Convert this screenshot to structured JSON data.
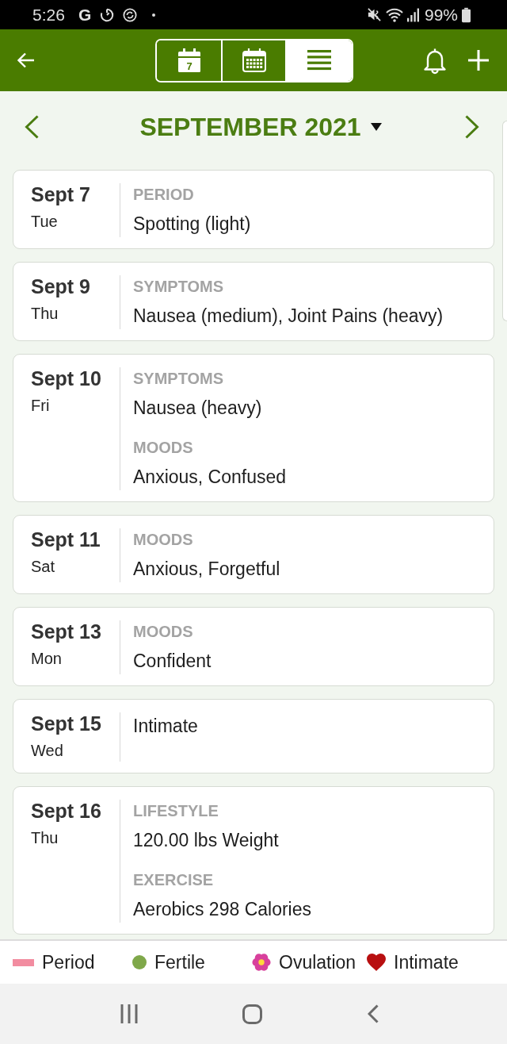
{
  "status_bar": {
    "time": "5:26",
    "app_letter": "G",
    "battery": "99%"
  },
  "view_tabs": [
    {
      "kind": "week",
      "selected": false,
      "badge": "7"
    },
    {
      "kind": "month",
      "selected": false
    },
    {
      "kind": "list",
      "selected": true
    }
  ],
  "header": {
    "title": "SEPTEMBER 2021"
  },
  "entries": [
    {
      "date": "Sept 7",
      "weekday": "Tue",
      "sections": [
        {
          "label": "PERIOD",
          "value": "Spotting (light)"
        }
      ]
    },
    {
      "date": "Sept 9",
      "weekday": "Thu",
      "sections": [
        {
          "label": "SYMPTOMS",
          "value": "Nausea (medium), Joint Pains (heavy)"
        }
      ]
    },
    {
      "date": "Sept 10",
      "weekday": "Fri",
      "sections": [
        {
          "label": "SYMPTOMS",
          "value": "Nausea (heavy)"
        },
        {
          "label": "MOODS",
          "value": "Anxious, Confused"
        }
      ]
    },
    {
      "date": "Sept 11",
      "weekday": "Sat",
      "sections": [
        {
          "label": "MOODS",
          "value": "Anxious, Forgetful"
        }
      ]
    },
    {
      "date": "Sept 13",
      "weekday": "Mon",
      "sections": [
        {
          "label": "MOODS",
          "value": "Confident"
        }
      ]
    },
    {
      "date": "Sept 15",
      "weekday": "Wed",
      "sections": [
        {
          "value": "Intimate"
        }
      ]
    },
    {
      "date": "Sept 16",
      "weekday": "Thu",
      "sections": [
        {
          "label": "LIFESTYLE",
          "value": "120.00 lbs Weight"
        },
        {
          "label": "EXERCISE",
          "value": "Aerobics 298 Calories"
        }
      ]
    }
  ],
  "legend": [
    {
      "kind": "bar",
      "color": "#f28ca0",
      "label": "Period"
    },
    {
      "kind": "dot",
      "color": "#7fa84a",
      "label": "Fertile"
    },
    {
      "kind": "flower",
      "color": "#d8409c",
      "label": "Ovulation"
    },
    {
      "kind": "heart",
      "color": "#b80f10",
      "label": "Intimate"
    }
  ]
}
